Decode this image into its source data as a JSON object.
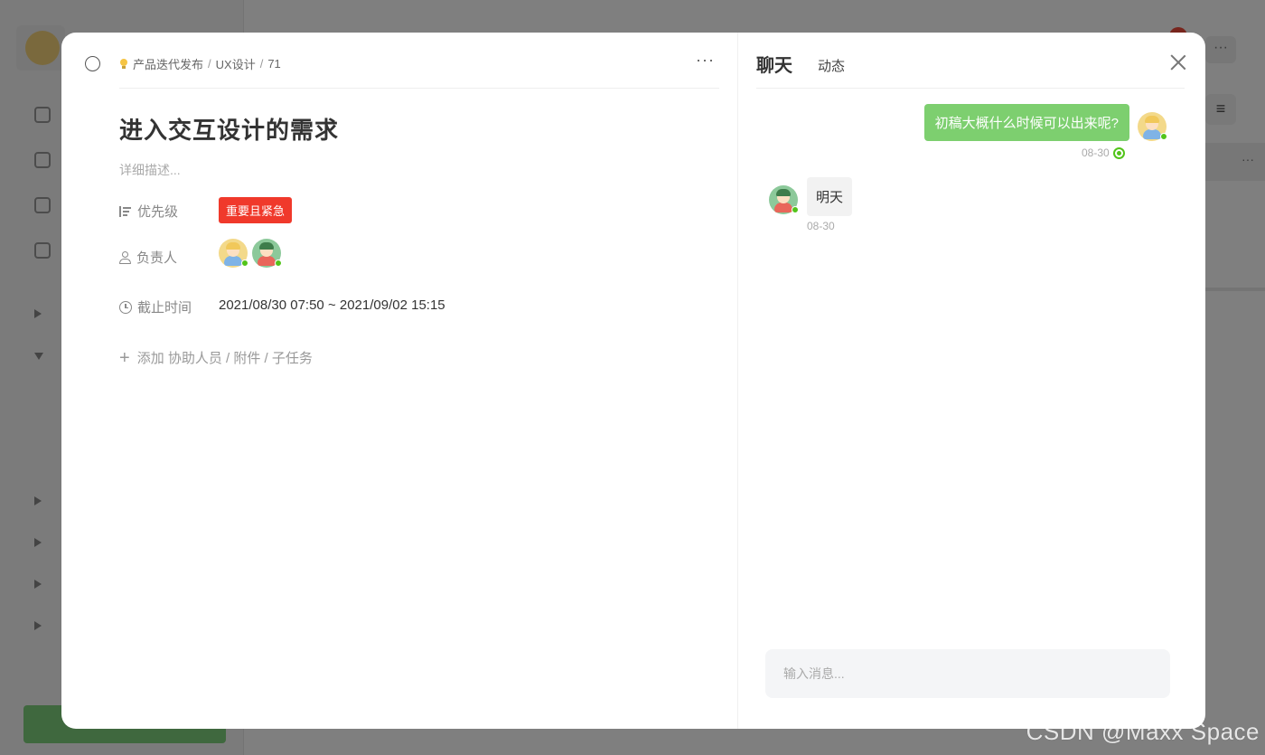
{
  "watermark": "CSDN @Maxx Space",
  "task": {
    "breadcrumb": [
      "产品迭代发布",
      "UX设计",
      "71"
    ],
    "breadcrumb_separator": "/",
    "more_label": "···",
    "title": "进入交互设计的需求",
    "description_placeholder": "详细描述...",
    "fields": {
      "priority_label": "优先级",
      "priority_value": "重要且紧急",
      "assignee_label": "负责人",
      "deadline_label": "截止时间",
      "deadline_value": "2021/08/30 07:50 ~ 2021/09/02 15:15"
    },
    "add_link": "添加 协助人员 / 附件 / 子任务"
  },
  "panel": {
    "tabs": [
      "聊天",
      "动态"
    ],
    "active_tab": "聊天",
    "messages": [
      {
        "from": "me",
        "text": "初稿大概什么时候可以出来呢?",
        "time": "08-30",
        "read": true
      },
      {
        "from": "other",
        "text": "明天",
        "time": "08-30"
      }
    ],
    "input_placeholder": "输入消息..."
  },
  "colors": {
    "priority_badge": "#f0392b",
    "my_bubble": "#7dcf6f",
    "online_dot": "#52c41a"
  },
  "icons": [
    "circle-check-icon",
    "bulb-icon",
    "priority-icon",
    "person-icon",
    "clock-icon",
    "plus-icon",
    "close-icon",
    "read-receipt-icon"
  ]
}
